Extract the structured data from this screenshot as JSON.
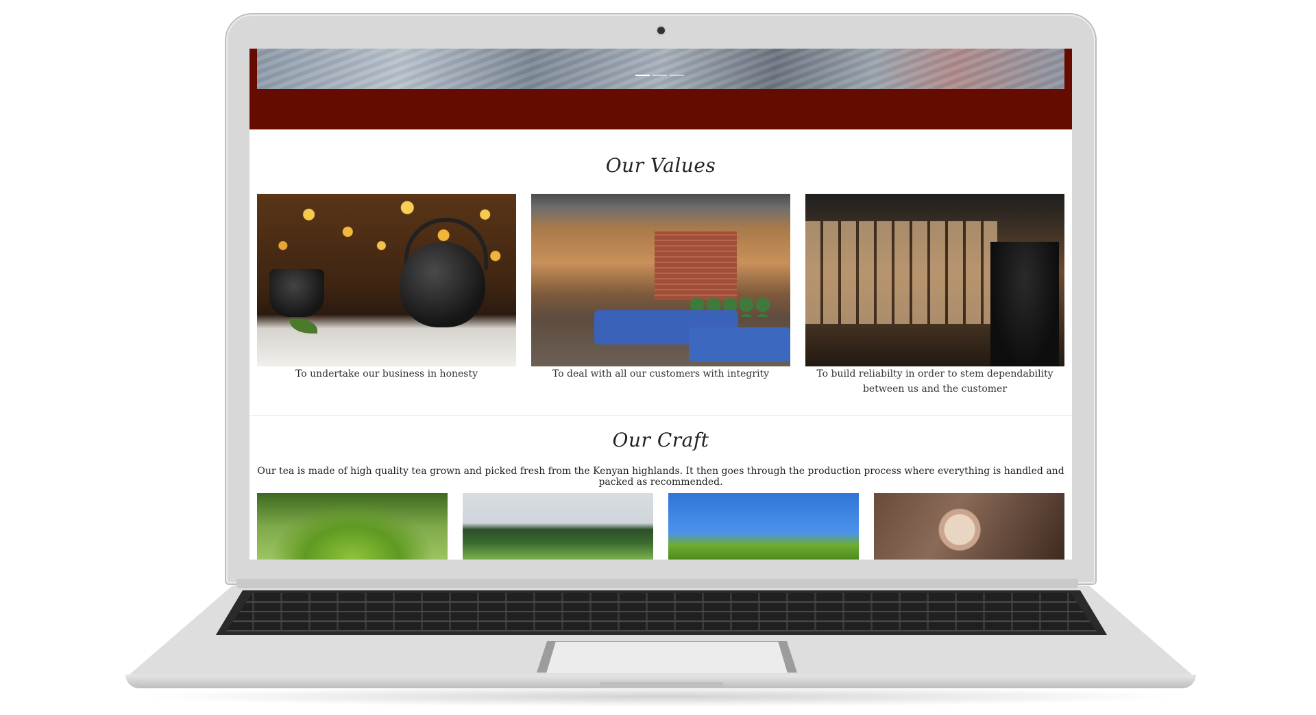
{
  "hero": {
    "slides_count": 3,
    "active_slide": 1
  },
  "values": {
    "title": "Our Values",
    "cards": [
      {
        "caption": "To undertake our business in honesty",
        "image": "teapot-bokeh-photo"
      },
      {
        "caption": "To deal with all our customers with integrity",
        "image": "cafe-lounge-photo"
      },
      {
        "caption": "To build reliabilty in order to stem dependability between us and the customer",
        "image": "coworking-cafe-photo"
      }
    ]
  },
  "craft": {
    "title": "Our Craft",
    "description": "Our tea is made of high quality tea grown and picked fresh from the Kenyan highlands. It then goes through the production process where everything is handled and packed as recommended.",
    "images": [
      "tea-leaves-photo",
      "tea-hills-photo",
      "tea-field-sky-photo",
      "tea-cup-photo"
    ]
  },
  "colors": {
    "brand_red": "#650b00",
    "text": "#222222"
  }
}
